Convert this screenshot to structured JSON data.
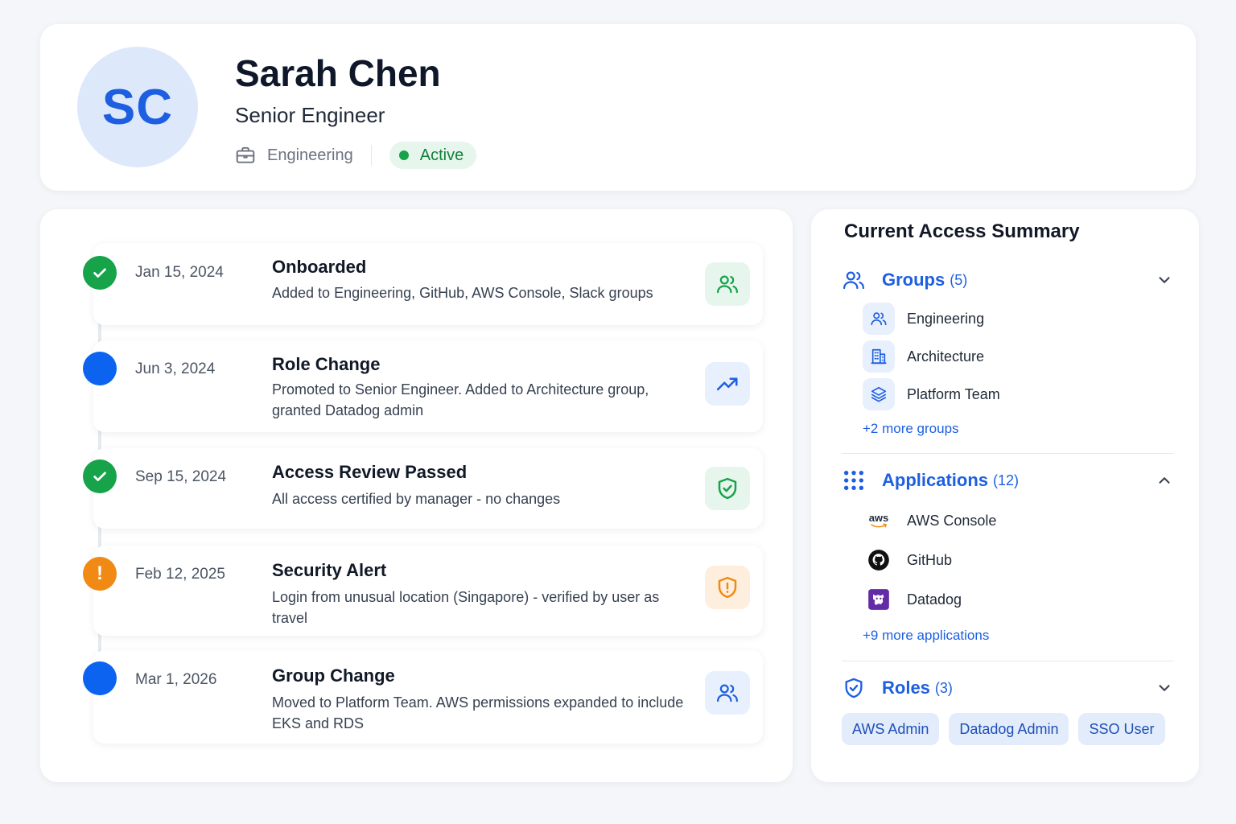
{
  "profile": {
    "initials": "SC",
    "name": "Sarah Chen",
    "title": "Senior Engineer",
    "department": "Engineering",
    "status": "Active"
  },
  "timeline": [
    {
      "date": "Jan 15, 2024",
      "title": "Onboarded",
      "description": "Added to Engineering, GitHub, AWS Console, Slack groups",
      "marker": "check-icon",
      "icon": "users-icon",
      "tone": "green"
    },
    {
      "date": "Jun 3, 2024",
      "title": "Role Change",
      "description": "Promoted to Senior Engineer. Added to Architecture group, granted Datadog admin",
      "marker": "dot",
      "icon": "trending-up-icon",
      "tone": "blue"
    },
    {
      "date": "Sep 15, 2024",
      "title": "Access Review Passed",
      "description": "All access certified by manager - no changes",
      "marker": "check-icon",
      "icon": "shield-check-icon",
      "tone": "green"
    },
    {
      "date": "Feb 12, 2025",
      "title": "Security Alert",
      "description": "Login from unusual location (Singapore) - verified by user as travel",
      "marker_text": "!",
      "icon": "shield-alert-icon",
      "tone": "orange"
    },
    {
      "date": "Mar 1, 2026",
      "title": "Group Change",
      "description": "Moved to Platform Team. AWS permissions expanded to include EKS and RDS",
      "marker": "dot",
      "icon": "users-icon",
      "tone": "blue"
    }
  ],
  "summary": {
    "title": "Current Access Summary",
    "groups": {
      "label": "Groups",
      "count": "(5)",
      "expanded": false,
      "items": [
        {
          "label": "Engineering",
          "icon": "users-icon"
        },
        {
          "label": "Architecture",
          "icon": "building-icon"
        },
        {
          "label": "Platform Team",
          "icon": "layers-icon"
        }
      ],
      "more": "+2 more groups"
    },
    "applications": {
      "label": "Applications",
      "count": "(12)",
      "expanded": true,
      "items": [
        {
          "label": "AWS Console",
          "icon": "aws-logo-icon",
          "logo_text": "aws"
        },
        {
          "label": "GitHub",
          "icon": "github-icon"
        },
        {
          "label": "Datadog",
          "icon": "datadog-icon"
        }
      ],
      "more": "+9 more applications"
    },
    "roles": {
      "label": "Roles",
      "count": "(3)",
      "expanded": false,
      "items": [
        "AWS Admin",
        "Datadog Admin",
        "SSO User"
      ]
    }
  },
  "colors": {
    "accent": "#1d5fe0",
    "success": "#16a34a",
    "info": "#0b63f0",
    "warning": "#f08a14",
    "background": "#f4f6fa"
  }
}
